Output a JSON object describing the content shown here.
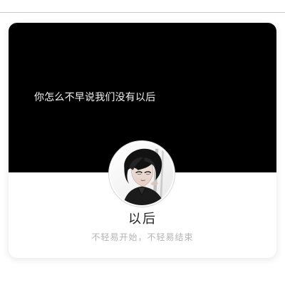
{
  "profile_card": {
    "cover_text": "你怎么不早说我们没有以后",
    "name": "以后",
    "signature": "不轻易开始，不轻易结束",
    "avatar_icon": "anime-boy-avatar-icon"
  },
  "colors": {
    "cover_bg": "#000000",
    "card_bg": "#ffffff",
    "cover_text": "#f2f2f2",
    "name_text": "#222222",
    "signature_text": "#b4b4b4"
  }
}
